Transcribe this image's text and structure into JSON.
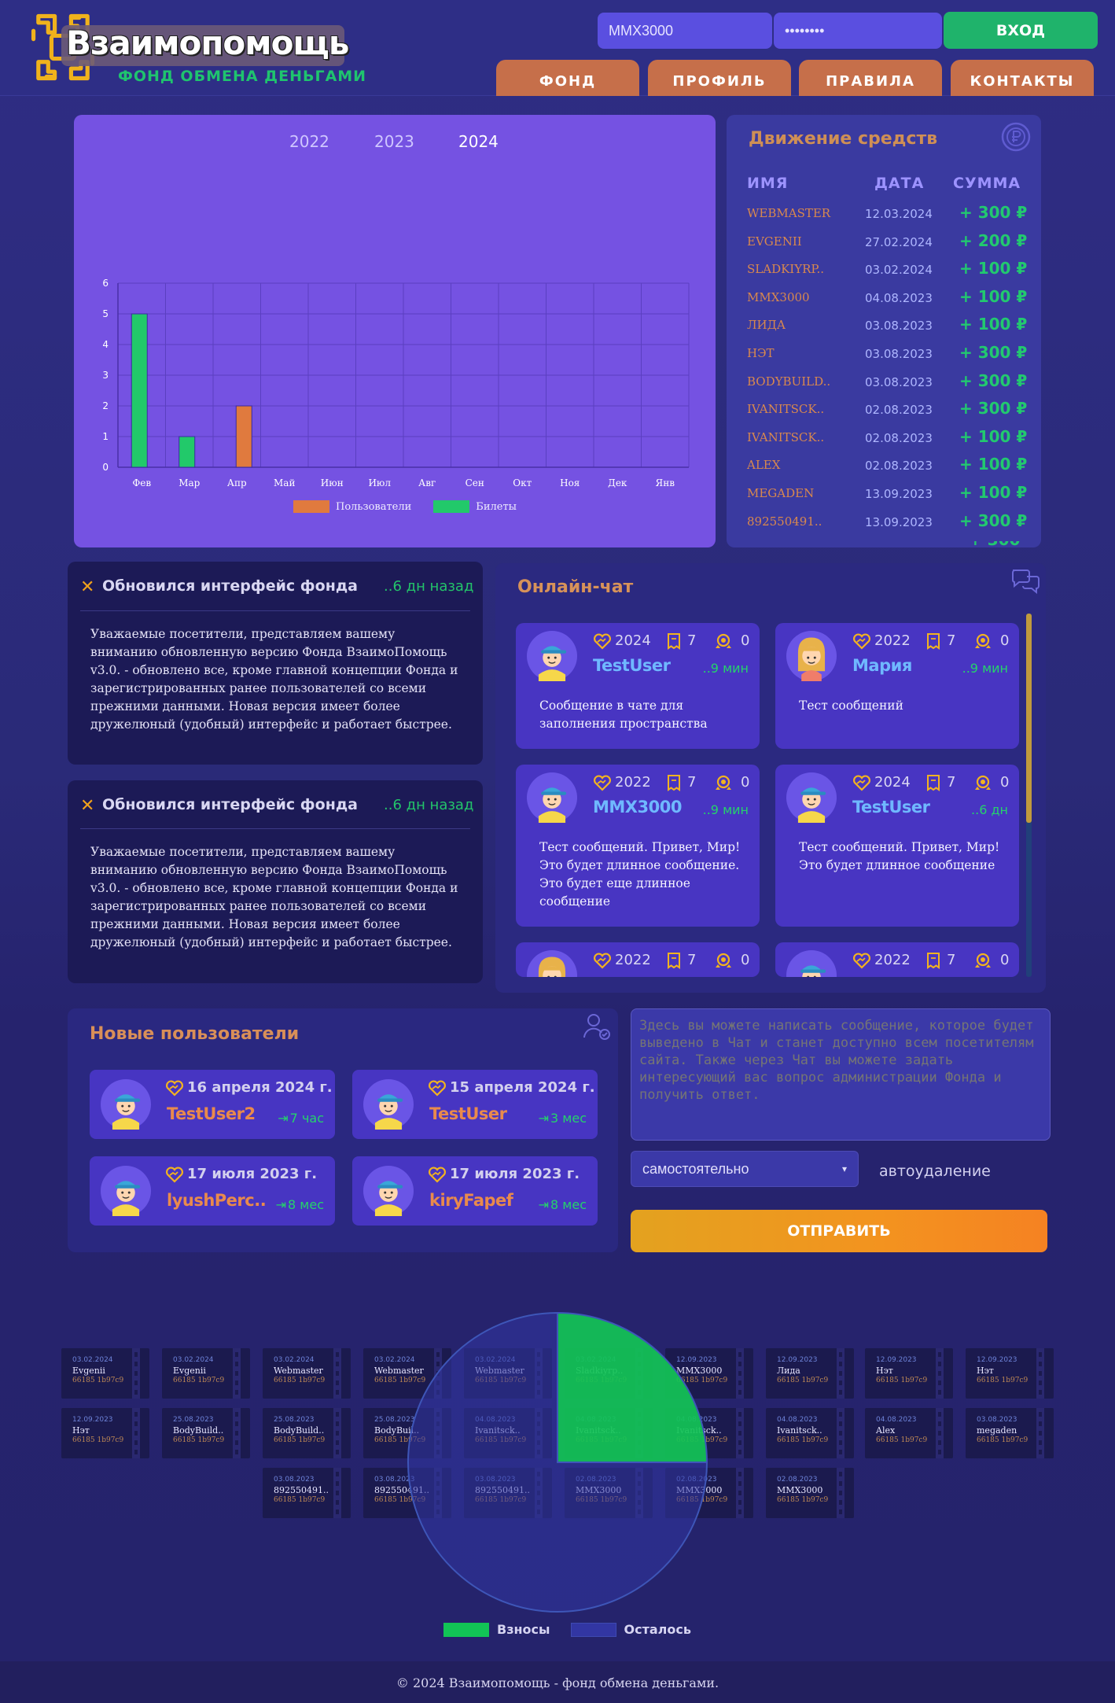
{
  "header": {
    "logo_title": "Взаимопомощь",
    "logo_subtitle": "ФОНД ОБМЕНА ДЕНЬГАМИ",
    "login_value": "MMX3000",
    "password_value": "••••••••",
    "login_button": "ВХОД",
    "nav": [
      "ФОНД",
      "ПРОФИЛЬ",
      "ПРАВИЛА",
      "КОНТАКТЫ"
    ]
  },
  "chart_data": {
    "type": "bar",
    "years": [
      "2022",
      "2023",
      "2024"
    ],
    "selected_year": "2024",
    "categories": [
      "Фев",
      "Мар",
      "Апр",
      "Май",
      "Июн",
      "Июл",
      "Авг",
      "Сен",
      "Окт",
      "Ноя",
      "Дек",
      "Янв"
    ],
    "series": [
      {
        "name": "Пользователи",
        "color": "#e07a3e",
        "values": [
          0,
          0,
          2,
          0,
          0,
          0,
          0,
          0,
          0,
          0,
          0,
          0
        ]
      },
      {
        "name": "Билеты",
        "color": "#22c96a",
        "values": [
          5,
          1,
          0,
          0,
          0,
          0,
          0,
          0,
          0,
          0,
          0,
          0
        ]
      }
    ],
    "yticks": [
      "0",
      "1",
      "2",
      "3",
      "4",
      "5",
      "6"
    ],
    "ylim": [
      0,
      6
    ],
    "grid": true,
    "legend": "bottom-center"
  },
  "money": {
    "title": "Движение средств",
    "headers": {
      "name": "ИМЯ",
      "date": "ДАТА",
      "sum": "СУММА"
    },
    "rows": [
      {
        "name": "WEBMASTER",
        "date": "12.03.2024",
        "sum": "+ 300 ₽"
      },
      {
        "name": "EVGENII",
        "date": "27.02.2024",
        "sum": "+ 200 ₽"
      },
      {
        "name": "SLADKIYRP..",
        "date": "03.02.2024",
        "sum": "+ 100 ₽"
      },
      {
        "name": "MMX3000",
        "date": "04.08.2023",
        "sum": "+ 100 ₽"
      },
      {
        "name": "ЛИДА",
        "date": "03.08.2023",
        "sum": "+ 100 ₽"
      },
      {
        "name": "НЭТ",
        "date": "03.08.2023",
        "sum": "+ 300 ₽"
      },
      {
        "name": "BODYBUILD..",
        "date": "03.08.2023",
        "sum": "+ 300 ₽"
      },
      {
        "name": "IVANITSCK..",
        "date": "02.08.2023",
        "sum": "+ 300 ₽"
      },
      {
        "name": "IVANITSCK..",
        "date": "02.08.2023",
        "sum": "+ 100 ₽"
      },
      {
        "name": "ALEX",
        "date": "02.08.2023",
        "sum": "+ 100 ₽"
      },
      {
        "name": "MEGADEN",
        "date": "13.09.2023",
        "sum": "+ 100 ₽"
      },
      {
        "name": "892550491..",
        "date": "13.09.2023",
        "sum": "+ 300 ₽"
      }
    ]
  },
  "news": [
    {
      "title": "Обновился интерфейс фонда",
      "time": "..6 дн назад",
      "body": "Уважаемые посетители, представляем вашему вниманию обновленную версию Фонда ВзаимоПомощь v3.0. - обновлено все, кроме главной концепции Фонда и зарегистрированных ранее пользователей со всеми прежними данными. Новая версия имеет более дружелюный (удобный) интерфейс и работает быстрее."
    },
    {
      "title": "Обновился интерфейс фонда",
      "time": "..6 дн назад",
      "body": "Уважаемые посетители, представляем вашему вниманию обновленную версию Фонда ВзаимоПомощь v3.0. - обновлено все, кроме главной концепции Фонда и зарегистрированных ранее пользователей со всеми прежними данными. Новая версия имеет более дружелюный (удобный) интерфейс и работает быстрее."
    }
  ],
  "chat": {
    "title": "Онлайн-чат",
    "messages": [
      {
        "year": "2024",
        "tickets": "7",
        "awards": "0",
        "user": "TestUser",
        "ago": "..9 мин",
        "avatar": "boy",
        "text": "Сообщение в чате для заполнения пространства"
      },
      {
        "year": "2022",
        "tickets": "7",
        "awards": "0",
        "user": "Мария",
        "ago": "..9 мин",
        "avatar": "girl",
        "text": "Тест сообщений"
      },
      {
        "year": "2022",
        "tickets": "7",
        "awards": "0",
        "user": "MMX3000",
        "ago": "..9 мин",
        "avatar": "boy",
        "text": "Тест сообщений. Привет, Мир! Это будет длинное сообщение. Это будет еще длинное сообщение"
      },
      {
        "year": "2024",
        "tickets": "7",
        "awards": "0",
        "user": "TestUser",
        "ago": "..6 дн",
        "avatar": "boy",
        "text": "Тест сообщений. Привет, Мир! Это будет длинное сообщение"
      },
      {
        "year": "2022",
        "tickets": "7",
        "awards": "0",
        "user": "",
        "ago": "",
        "avatar": "girl",
        "text": ""
      },
      {
        "year": "2022",
        "tickets": "7",
        "awards": "0",
        "user": "",
        "ago": "",
        "avatar": "boy",
        "text": ""
      }
    ]
  },
  "new_users": {
    "title": "Новые пользователи",
    "items": [
      {
        "date": "16 апреля 2024 г.",
        "name": "TestUser2",
        "ago": "7 час"
      },
      {
        "date": "15 апреля 2024 г.",
        "name": "TestUser",
        "ago": "3 мес"
      },
      {
        "date": "17 июля 2023 г.",
        "name": "lyushPerc..",
        "ago": "8 мес"
      },
      {
        "date": "17 июля 2023 г.",
        "name": "kiryFapef",
        "ago": "8 мес"
      }
    ]
  },
  "message_form": {
    "placeholder": "Здесь вы можете написать сообщение, которое будет выведено в Чат и станет доступно всем посетителям сайта. Также через Чат вы можете задать интересующий вас вопрос администрации Фонда и получить ответ.",
    "select_value": "самостоятельно",
    "autodelete_label": "автоудаление",
    "send_button": "ОТПРАВИТЬ"
  },
  "tickets": [
    {
      "date": "03.02.2024",
      "name": "Evgenii",
      "code": "66185 1b97c9"
    },
    {
      "date": "03.02.2024",
      "name": "Evgenii",
      "code": "66185 1b97c9"
    },
    {
      "date": "03.02.2024",
      "name": "Webmaster",
      "code": "66185 1b97c9"
    },
    {
      "date": "03.02.2024",
      "name": "Webmaster",
      "code": "66185 1b97c9"
    },
    {
      "date": "03.02.2024",
      "name": "Webmaster",
      "code": "66185 1b97c9"
    },
    {
      "date": "03.02.2024",
      "name": "Sladkiyrp..",
      "code": "66185 1b97c9"
    },
    {
      "date": "12.09.2023",
      "name": "MMX3000",
      "code": "66185 1b97c9"
    },
    {
      "date": "12.09.2023",
      "name": "Лида",
      "code": "66185 1b97c9"
    },
    {
      "date": "12.09.2023",
      "name": "Нэт",
      "code": "66185 1b97c9"
    },
    {
      "date": "12.09.2023",
      "name": "Нэт",
      "code": "66185 1b97c9"
    },
    {
      "date": "12.09.2023",
      "name": "Нэт",
      "code": "66185 1b97c9"
    },
    {
      "date": "25.08.2023",
      "name": "BodyBuild..",
      "code": "66185 1b97c9"
    },
    {
      "date": "25.08.2023",
      "name": "BodyBuild..",
      "code": "66185 1b97c9"
    },
    {
      "date": "25.08.2023",
      "name": "BodyBuil..",
      "code": "66185 1b97c9"
    },
    {
      "date": "04.08.2023",
      "name": "Ivanitsck..",
      "code": "66185 1b97c9"
    },
    {
      "date": "04.08.2023",
      "name": "Ivanitsck..",
      "code": "66185 1b97c9"
    },
    {
      "date": "04.08.2023",
      "name": "Ivanitsck..",
      "code": "66185 1b97c9"
    },
    {
      "date": "04.08.2023",
      "name": "Ivanitsck..",
      "code": "66185 1b97c9"
    },
    {
      "date": "04.08.2023",
      "name": "Alex",
      "code": "66185 1b97c9"
    },
    {
      "date": "03.08.2023",
      "name": "megaden",
      "code": "66185 1b97c9"
    },
    {
      "date": "03.08.2023",
      "name": "892550491..",
      "code": "66185 1b97c9"
    },
    {
      "date": "03.08.2023",
      "name": "892550491..",
      "code": "66185 1b97c9"
    },
    {
      "date": "03.08.2023",
      "name": "892550491..",
      "code": "66185 1b97c9"
    },
    {
      "date": "02.08.2023",
      "name": "MMX3000",
      "code": "66185 1b97c9"
    },
    {
      "date": "02.08.2023",
      "name": "MMX3000",
      "code": "66185 1b97c9"
    },
    {
      "date": "02.08.2023",
      "name": "MMX3000",
      "code": "66185 1b97c9"
    }
  ],
  "pie": {
    "type": "pie",
    "slices": [
      {
        "name": "Взносы",
        "fraction": 0.25,
        "color": "#12c456"
      },
      {
        "name": "Осталось",
        "fraction": 0.75,
        "color": "#3236a3"
      }
    ]
  },
  "footer": "© 2024 Взаимопомощь - фонд обмена деньгами."
}
